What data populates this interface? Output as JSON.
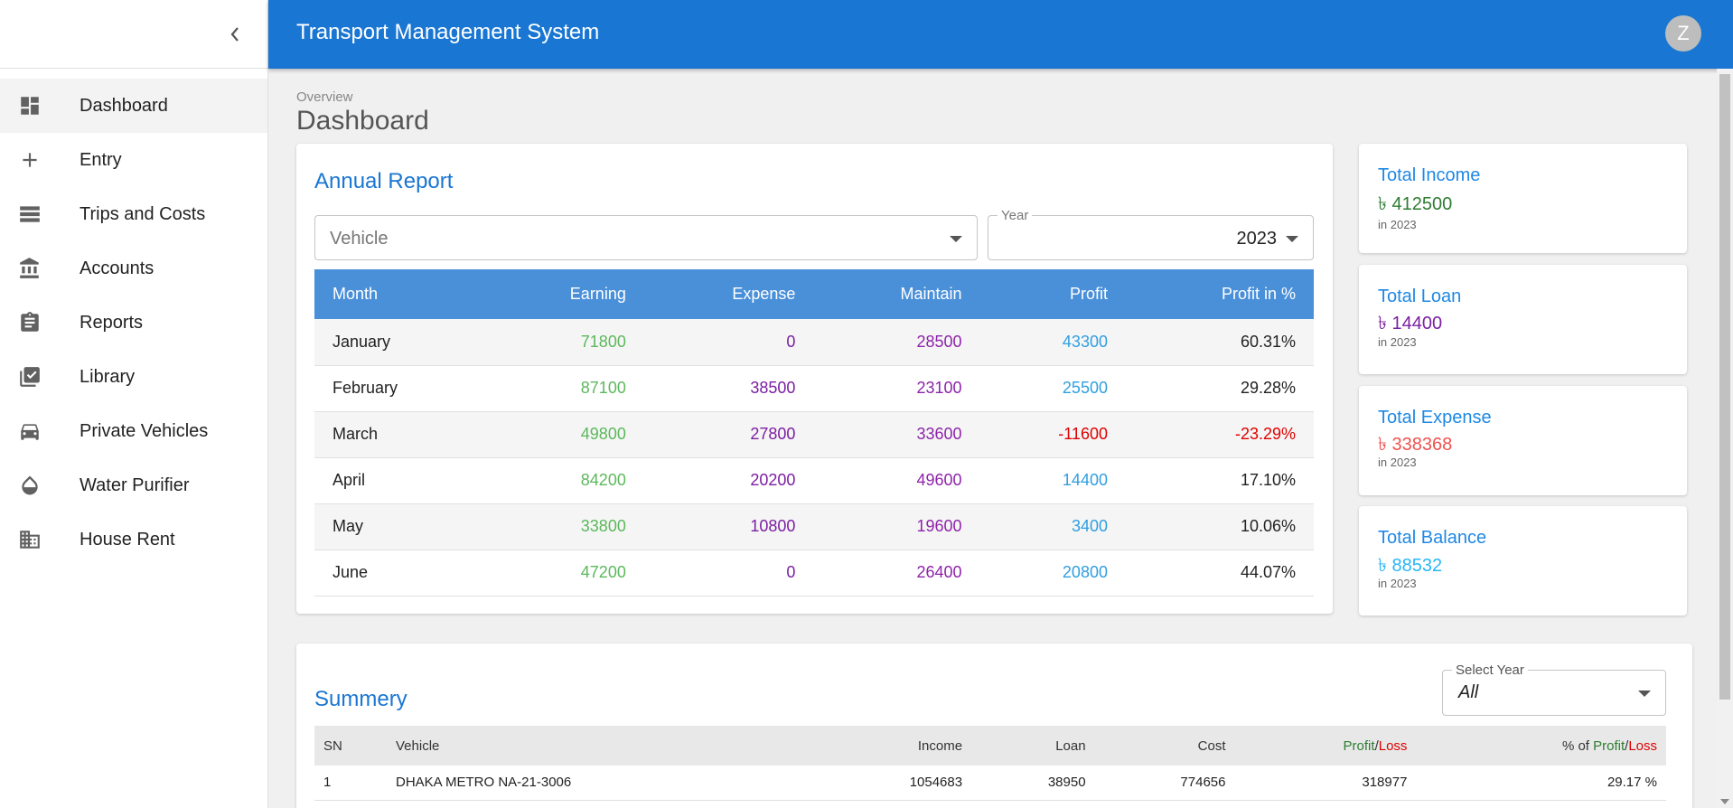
{
  "app": {
    "title": "Transport Management System",
    "avatar_letter": "Z"
  },
  "sidebar": {
    "items": [
      {
        "label": "Dashboard",
        "icon": "dashboard-icon",
        "active": true
      },
      {
        "label": "Entry",
        "icon": "plus-icon"
      },
      {
        "label": "Trips and Costs",
        "icon": "list-icon"
      },
      {
        "label": "Accounts",
        "icon": "bank-icon"
      },
      {
        "label": "Reports",
        "icon": "clipboard-icon"
      },
      {
        "label": "Library",
        "icon": "library-check-icon"
      },
      {
        "label": "Private Vehicles",
        "icon": "car-icon"
      },
      {
        "label": "Water Purifier",
        "icon": "water-drop-icon"
      },
      {
        "label": "House Rent",
        "icon": "building-icon"
      }
    ]
  },
  "page": {
    "breadcrumb": "Overview",
    "title": "Dashboard"
  },
  "annual": {
    "title": "Annual Report",
    "vehicle_placeholder": "Vehicle",
    "year_label": "Year",
    "year_value": "2023",
    "headers": [
      "Month",
      "Earning",
      "Expense",
      "Maintain",
      "Profit",
      "Profit in %"
    ],
    "rows": [
      {
        "month": "January",
        "earning": "71800",
        "expense": "0",
        "maintain": "28500",
        "profit": "43300",
        "pct": "60.31%",
        "neg": false
      },
      {
        "month": "February",
        "earning": "87100",
        "expense": "38500",
        "maintain": "23100",
        "profit": "25500",
        "pct": "29.28%",
        "neg": false
      },
      {
        "month": "March",
        "earning": "49800",
        "expense": "27800",
        "maintain": "33600",
        "profit": "-11600",
        "pct": "-23.29%",
        "neg": true
      },
      {
        "month": "April",
        "earning": "84200",
        "expense": "20200",
        "maintain": "49600",
        "profit": "14400",
        "pct": "17.10%",
        "neg": false
      },
      {
        "month": "May",
        "earning": "33800",
        "expense": "10800",
        "maintain": "19600",
        "profit": "3400",
        "pct": "10.06%",
        "neg": false
      },
      {
        "month": "June",
        "earning": "47200",
        "expense": "0",
        "maintain": "26400",
        "profit": "20800",
        "pct": "44.07%",
        "neg": false
      }
    ]
  },
  "stats": [
    {
      "label": "Total Income",
      "value": "৳ 412500",
      "sub": "in 2023",
      "color": "#2e7d32"
    },
    {
      "label": "Total Loan",
      "value": "৳ 14400",
      "sub": "in 2023",
      "color": "#7b1fa2"
    },
    {
      "label": "Total Expense",
      "value": "৳ 338368",
      "sub": "in 2023",
      "color": "#ef5350"
    },
    {
      "label": "Total Balance",
      "value": "৳ 88532",
      "sub": "in 2023",
      "color": "#29b6f6"
    }
  ],
  "summary": {
    "title": "Summery",
    "year_label": "Select Year",
    "year_value": "All",
    "headers": {
      "sn": "SN",
      "vehicle": "Vehicle",
      "income": "Income",
      "loan": "Loan",
      "cost": "Cost",
      "profit": "Profit",
      "slash": "/",
      "loss": "Loss",
      "pct_prefix": "% of "
    },
    "rows": [
      {
        "sn": "1",
        "vehicle": "DHAKA METRO NA-21-3006",
        "income": "1054683",
        "loan": "38950",
        "cost": "774656",
        "profit": "318977",
        "pct": "29.17 %"
      }
    ]
  }
}
